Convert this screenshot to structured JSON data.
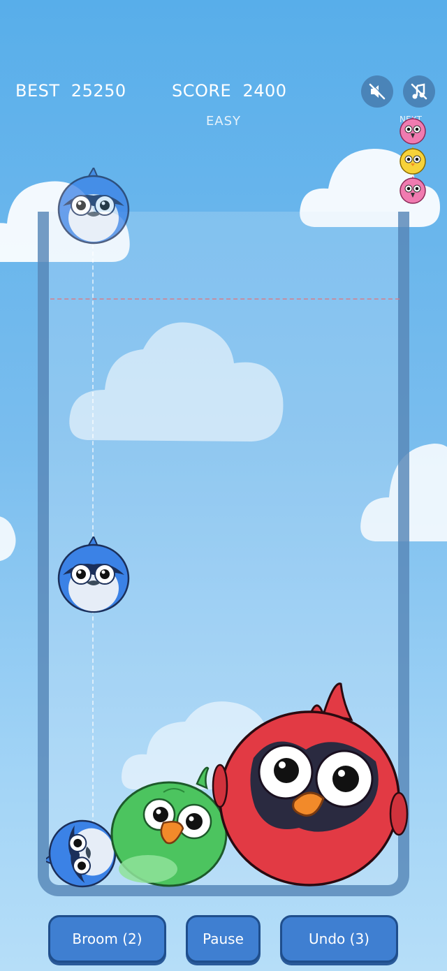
{
  "hud": {
    "best_label": "BEST",
    "best_value": "25250",
    "score_label": "SCORE",
    "score_value": "2400",
    "mode": "EASY",
    "next_label": "NEXT"
  },
  "controls": {
    "sound_icon": "sound-off-icon",
    "music_icon": "music-off-icon"
  },
  "next_queue": [
    "pink-bird",
    "yellow-bird",
    "pink-bird"
  ],
  "held_bird": "blue-jay",
  "board_birds": [
    "blue-jay",
    "blue-jay",
    "green-parrot",
    "red-cardinal"
  ],
  "actions": {
    "broom": "Broom (2)",
    "pause": "Pause",
    "undo": "Undo (3)"
  },
  "colors": {
    "sky_top": "#58aeea",
    "sky_bottom": "#b6def8",
    "button": "#3f7fd1",
    "cardinal": "#e23a44",
    "parrot": "#4cc45f",
    "blue_jay": "#3b82e6"
  }
}
